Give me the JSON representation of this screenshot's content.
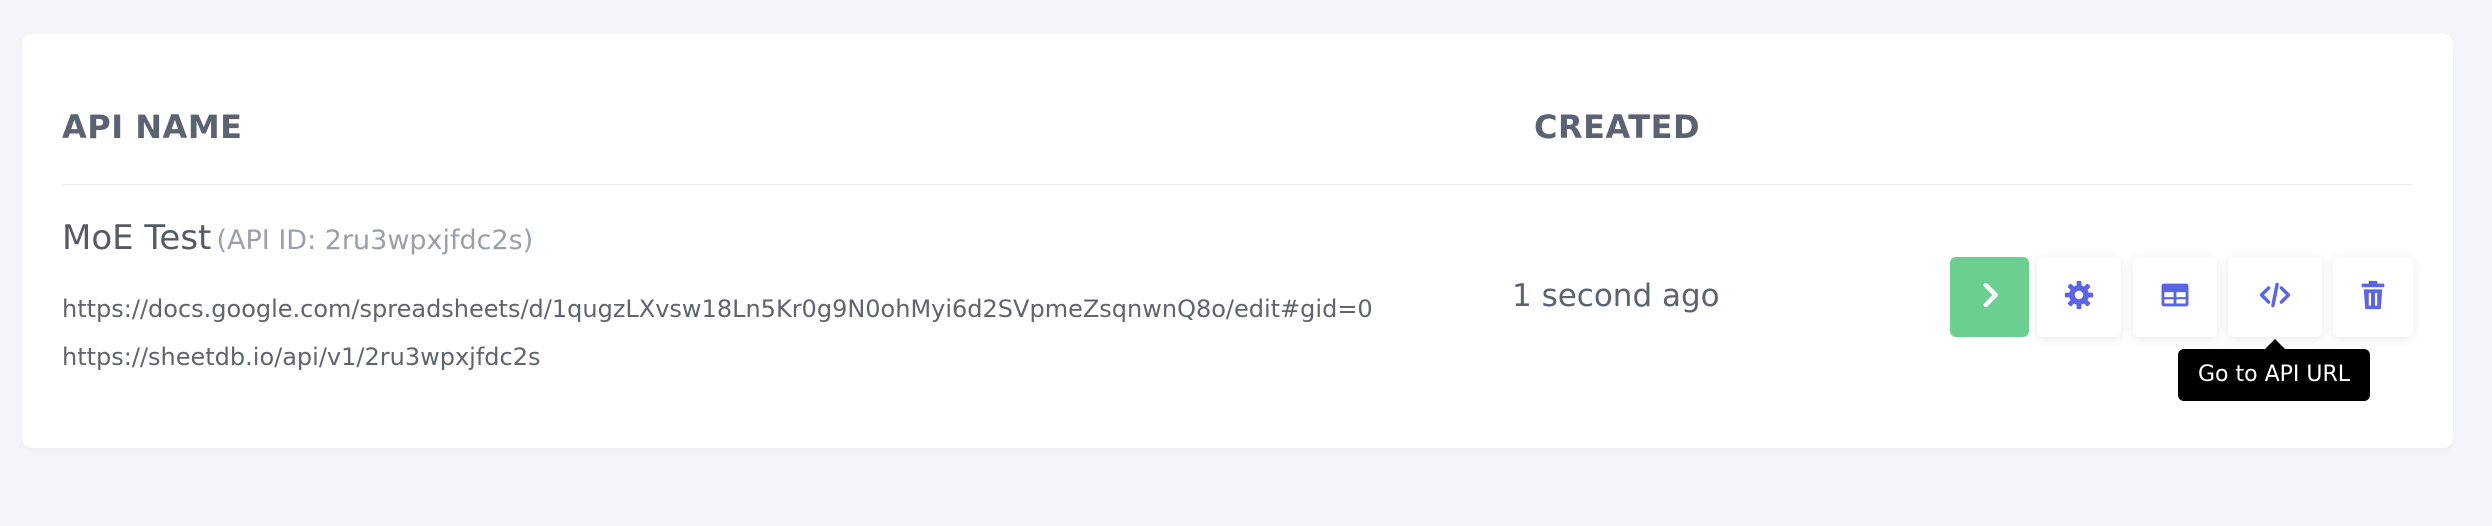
{
  "table": {
    "headers": {
      "api_name": "API NAME",
      "created": "CREATED"
    },
    "rows": [
      {
        "name": "MoE Test",
        "api_id": "(API ID: 2ru3wpxjfdc2s)",
        "sheet_url": "https://docs.google.com/spreadsheets/d/1qugzLXvsw18Ln5Kr0g9N0ohMyi6d2SVpmeZsqnwnQ8o/edit#gid=0",
        "api_url": "https://sheetdb.io/api/v1/2ru3wpxjfdc2s",
        "created": "1 second ago",
        "actions": [
          {
            "name": "go",
            "icon": "chevron-right-icon"
          },
          {
            "name": "settings",
            "icon": "gear-icon"
          },
          {
            "name": "sheet",
            "icon": "table-icon"
          },
          {
            "name": "api-url",
            "icon": "code-icon"
          },
          {
            "name": "delete",
            "icon": "trash-icon"
          }
        ]
      }
    ]
  },
  "tooltip": {
    "text": "Go to API URL"
  },
  "colors": {
    "accent": "#5b63e6",
    "go_button": "#6ccf92",
    "header_text": "#5b6272",
    "muted_text": "#9aa0aa",
    "tooltip_bg": "#000000"
  }
}
